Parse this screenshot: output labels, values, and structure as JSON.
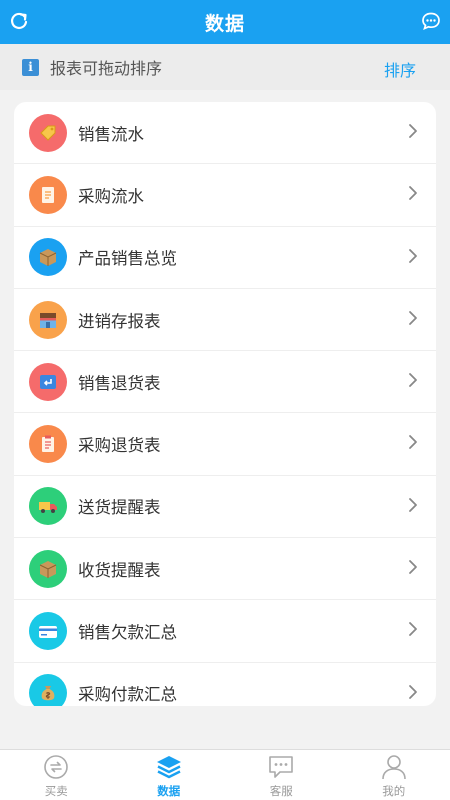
{
  "header": {
    "title": "数据",
    "left_icon": "refresh-icon",
    "right_icon": "chat-bubble-icon"
  },
  "notice": {
    "icon": "info-icon",
    "info_glyph": "i",
    "text": "报表可拖动排序",
    "sort_label": "排序"
  },
  "reports": [
    {
      "label": "销售流水",
      "icon": "price-tag-icon",
      "color": "#f56b6b"
    },
    {
      "label": "采购流水",
      "icon": "document-icon",
      "color": "#f9894b"
    },
    {
      "label": "产品销售总览",
      "icon": "box-icon",
      "color": "#1aa1f1"
    },
    {
      "label": "进销存报表",
      "icon": "store-icon",
      "color": "#f9a24b"
    },
    {
      "label": "销售退货表",
      "icon": "return-icon",
      "color": "#f56b6b"
    },
    {
      "label": "采购退货表",
      "icon": "clipboard-icon",
      "color": "#f9894b"
    },
    {
      "label": "送货提醒表",
      "icon": "truck-icon",
      "color": "#2dcf7a"
    },
    {
      "label": "收货提醒表",
      "icon": "package-icon",
      "color": "#2dcf7a"
    },
    {
      "label": "销售欠款汇总",
      "icon": "credit-card-icon",
      "color": "#19c9e6"
    },
    {
      "label": "采购付款汇总",
      "icon": "money-bag-icon",
      "color": "#19c9e6"
    }
  ],
  "tabbar": {
    "tabs": [
      {
        "label": "买卖",
        "icon": "trade-icon",
        "active": false
      },
      {
        "label": "数据",
        "icon": "layers-icon",
        "active": true
      },
      {
        "label": "客服",
        "icon": "message-icon",
        "active": false
      },
      {
        "label": "我的",
        "icon": "person-icon",
        "active": false
      }
    ]
  },
  "colors": {
    "primary": "#1aa1f1",
    "background": "#f2f2f2",
    "inactive": "#999999"
  }
}
